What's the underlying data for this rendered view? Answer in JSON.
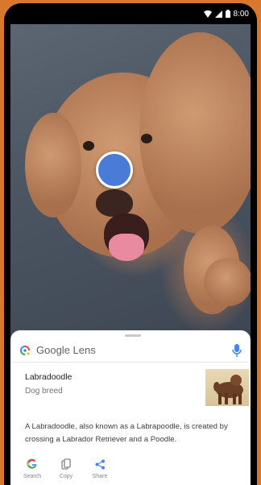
{
  "status_bar": {
    "time": "8:00",
    "icons": [
      "wifi-icon",
      "signal-icon",
      "battery-icon"
    ]
  },
  "camera": {
    "subject": "dog",
    "focus_indicator": "lens-dot-icon"
  },
  "lens_sheet": {
    "app_title": "Google Lens",
    "header_icons": [
      "lens-logo-icon",
      "microphone-icon"
    ],
    "result": {
      "title": "Labradoodle",
      "subtitle": "Dog breed",
      "description": "A Labradoodle, also known as a Labrapoodle, is created by crossing a Labrador Retriever and a Poodle."
    },
    "actions": [
      {
        "label": "Search",
        "icon": "google-g-icon"
      },
      {
        "label": "Copy",
        "icon": "copy-icon"
      },
      {
        "label": "Share",
        "icon": "share-icon"
      }
    ]
  },
  "colors": {
    "frame": "#d9772c",
    "lens_blue": "#4a7bd6",
    "sheet": "#ffffff"
  }
}
